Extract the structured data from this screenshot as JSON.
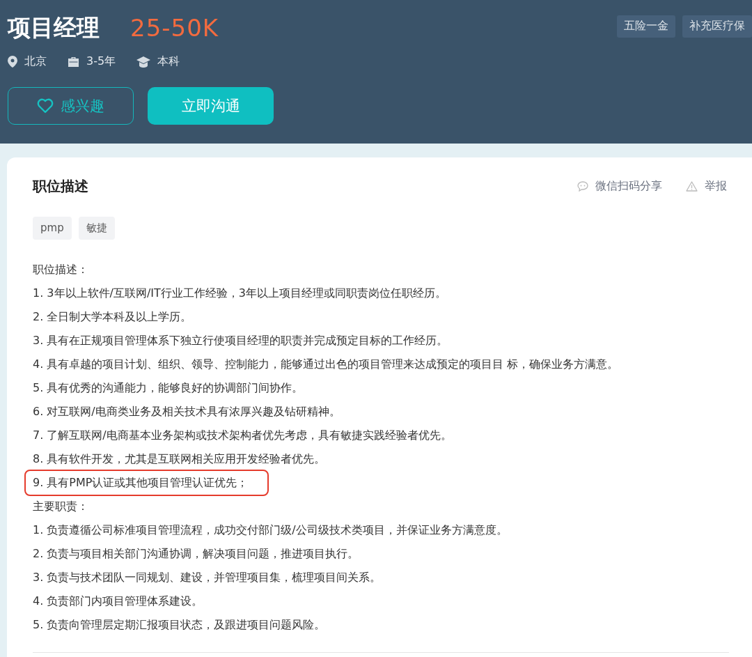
{
  "job": {
    "title": "项目经理",
    "salary": "25-50K",
    "meta": [
      {
        "kind": "location",
        "text": "北京"
      },
      {
        "kind": "experience",
        "text": "3-5年"
      },
      {
        "kind": "education",
        "text": "本科"
      }
    ],
    "benefits": [
      "五险一金",
      "补充医疗保"
    ],
    "buttons": [
      {
        "kind": "interest",
        "label": "感兴趣"
      },
      {
        "kind": "chat",
        "label": "立即沟通"
      }
    ]
  },
  "description": {
    "heading": "职位描述",
    "actions": [
      {
        "kind": "share",
        "label": "微信扫码分享"
      },
      {
        "kind": "report",
        "label": "举报"
      }
    ],
    "tags": [
      "pmp",
      "敏捷"
    ],
    "lines": [
      {
        "text": "职位描述：",
        "highlighted": false
      },
      {
        "text": "1. 3年以上软件/互联网/IT行业工作经验，3年以上项目经理或同职责岗位任职经历。",
        "highlighted": false
      },
      {
        "text": "2. 全日制大学本科及以上学历。",
        "highlighted": false
      },
      {
        "text": "3. 具有在正规项目管理体系下独立行使项目经理的职责并完成预定目标的工作经历。",
        "highlighted": false
      },
      {
        "text": "4. 具有卓越的项目计划、组织、领导、控制能力，能够通过出色的项目管理来达成预定的项目目 标，确保业务方满意。",
        "highlighted": false
      },
      {
        "text": "5. 具有优秀的沟通能力，能够良好的协调部门间协作。",
        "highlighted": false
      },
      {
        "text": "6. 对互联网/电商类业务及相关技术具有浓厚兴趣及钻研精神。",
        "highlighted": false
      },
      {
        "text": "7. 了解互联网/电商基本业务架构或技术架构者优先考虑，具有敏捷实践经验者优先。",
        "highlighted": false
      },
      {
        "text": "8. 具有软件开发，尤其是互联网相关应用开发经验者优先。",
        "highlighted": false
      },
      {
        "text": "9. 具有PMP认证或其他项目管理认证优先；",
        "highlighted": true
      },
      {
        "text": "主要职责：",
        "highlighted": false
      },
      {
        "text": "1. 负责遵循公司标准项目管理流程，成功交付部门级/公司级技术类项目，并保证业务方满意度。",
        "highlighted": false
      },
      {
        "text": "2. 负责与项目相关部门沟通协调，解决项目问题，推进项目执行。",
        "highlighted": false
      },
      {
        "text": "3. 负责与技术团队一同规划、建设，并管理项目集，梳理项目间关系。",
        "highlighted": false
      },
      {
        "text": "4. 负责部门内项目管理体系建设。",
        "highlighted": false
      },
      {
        "text": "5. 负责向管理层定期汇报项目状态，及跟进项目问题风险。",
        "highlighted": false
      }
    ]
  }
}
